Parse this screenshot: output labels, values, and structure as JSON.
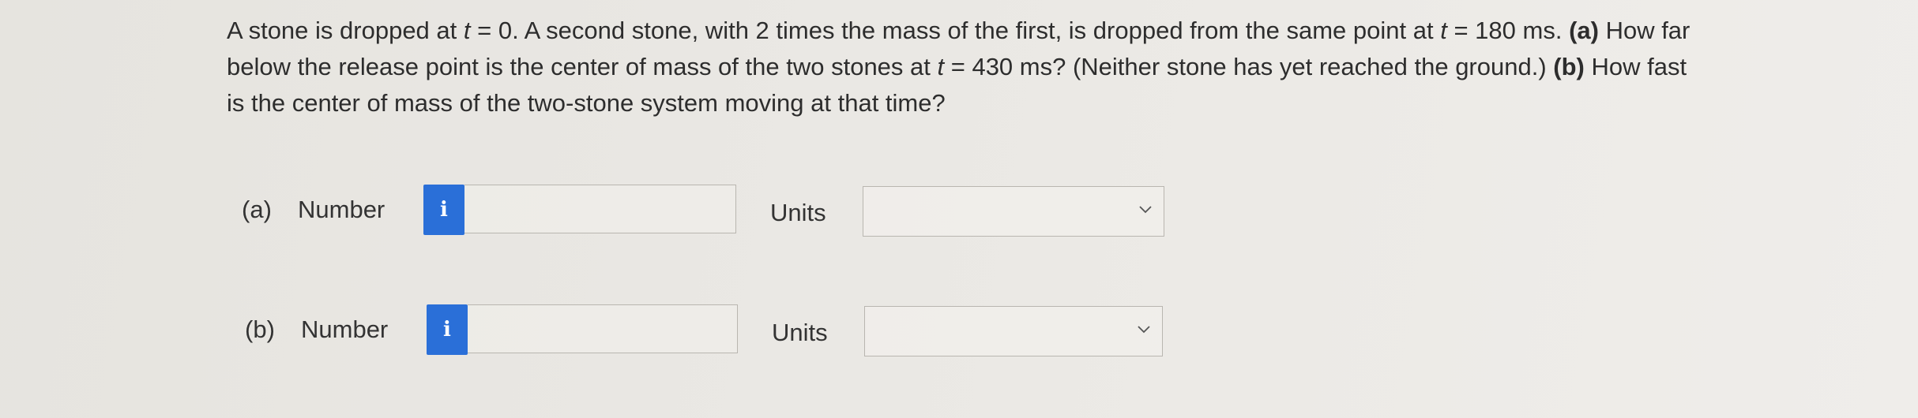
{
  "question": {
    "line1": [
      {
        "text": "A stone is dropped at ",
        "style": "normal"
      },
      {
        "text": "t",
        "style": "italic"
      },
      {
        "text": " = 0. A second stone, with 2 times the mass of the first, is dropped from the same point at ",
        "style": "normal"
      },
      {
        "text": "t",
        "style": "italic"
      },
      {
        "text": " = 180 ms. ",
        "style": "normal"
      },
      {
        "text": "(a)",
        "style": "bold"
      },
      {
        "text": " How far",
        "style": "normal"
      }
    ],
    "line2": [
      {
        "text": "below the release point is the center of mass of the two stones at ",
        "style": "normal"
      },
      {
        "text": "t",
        "style": "italic"
      },
      {
        "text": " = 430 ms? (Neither stone has yet reached the ground.) ",
        "style": "normal"
      },
      {
        "text": "(b)",
        "style": "bold"
      },
      {
        "text": " How fast",
        "style": "normal"
      }
    ],
    "line3": [
      {
        "text": "is the center of mass of the two-stone system moving at that time?",
        "style": "normal"
      }
    ]
  },
  "answers": {
    "a": {
      "part_label": "(a)",
      "number_label": "Number",
      "info_icon": "i",
      "number_value": "",
      "units_label": "Units",
      "units_selected": ""
    },
    "b": {
      "part_label": "(b)",
      "number_label": "Number",
      "info_icon": "i",
      "number_value": "",
      "units_label": "Units",
      "units_selected": ""
    }
  },
  "colors": {
    "info_button": "#2a6fd8",
    "text": "#2d2d2d",
    "border": "#b9b6b0"
  },
  "icons": {
    "info": "info-icon",
    "dropdown": "chevron-down-icon"
  }
}
